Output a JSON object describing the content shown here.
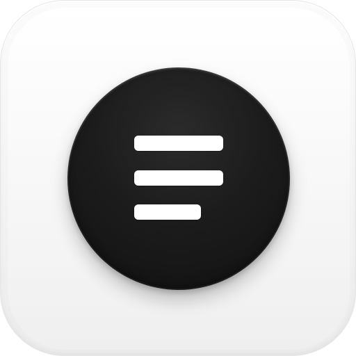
{
  "app_icon": {
    "name": "menu-app-icon",
    "tile_color": "#f4f4f4",
    "disc_color": "#1a1a1a",
    "glyph_color": "#ffffff",
    "glyph": "hamburger-menu-icon"
  }
}
